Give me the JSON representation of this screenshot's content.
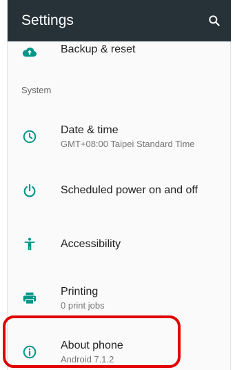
{
  "app_bar": {
    "title": "Settings",
    "search_icon": "search-icon",
    "color": "#263238"
  },
  "items": {
    "backup": {
      "title": "Backup & reset",
      "icon": "cloud-upload-icon"
    },
    "system_header": "System",
    "date_time": {
      "title": "Date & time",
      "summary": "GMT+08:00 Taipei Standard Time",
      "icon": "clock-icon"
    },
    "power": {
      "title": "Scheduled power on and off",
      "icon": "power-icon"
    },
    "accessibility": {
      "title": "Accessibility",
      "icon": "accessibility-icon"
    },
    "printing": {
      "title": "Printing",
      "summary": "0 print jobs",
      "icon": "printer-icon"
    },
    "about": {
      "title": "About phone",
      "summary": "Android 7.1.2",
      "icon": "info-icon"
    }
  },
  "colors": {
    "accent": "#009688",
    "highlight": "#e00000"
  }
}
